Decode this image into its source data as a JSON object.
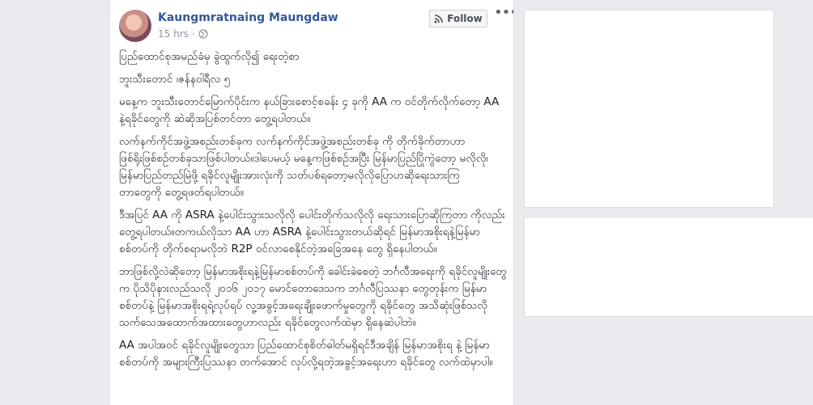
{
  "post": {
    "author": "Kaungmratnaing Maungdaw",
    "time": "15 hrs",
    "separator": "·",
    "privacy_icon": "globe-icon",
    "follow_label": "Follow",
    "follow_icon": "rss-icon",
    "more_label": "•••",
    "paragraphs": [
      "ပြည်ထောင်စုအမည်ခံမှ ခွဲထွက်လို၍ ရေးတဲ့စာ",
      "ဘူးသီးတောင် ၊ဇန်နဝါရီလ ၅",
      "မနေ့က ဘူးသီးတောင်မြောက်ပိုင်းက နယ်ခြားစောင့်စခန်း ၄ ခုကို AA က ဝင်တိုက်လိုက်တော့ AA နဲ့ရခိုင်တွေကို ဆဲဆိုအပြစ်တင်တာ တွေ့ရပါတယ်။",
      "လက်နက်ကိုင်အဖွဲ့အစည်းတစ်ခုက လက်နက်ကိုင်အဖွဲ့အစည်းတစ်ခု ကို တိုက်ခိုက်တာဟာ ဖြစ်ရိုးဖြစ်စဉ်တစ်ခုသာဖြစ်ပါတယ်။ဒါပေမယ့် မနေ့ကဖြစ်စဉ်အပြီး မြန်မာပြည်ပြိုကွဲတော့ မလိုလို၊မြန်မာပြည်တည်မြဲဖို့ ရခိုင်လူမျိုးအားလုံးကို သတ်ပစ်ရတော့မလိုလိုပြောဟဆိုရေးသားကြ\nတာတွေကို တွေ့ရဖတ်ရပါတယ်။",
      "ဒီအပြင် AA ကို ASRA နဲ့ပေါင်းသွားသလိုလို ပေါင်းတိုက်သလိုလို ရေးသားပြောဆိုကြတာ ကိုလည်း တွေ့ရပါတယ်။တကယ်လိုသာ AA ဟာ ASRA နဲ့ပေါင်းသွားတယ်ဆိုရင် မြန်မာအစိုးရနဲ့မြန်မာစစ်တပ်ကို တိုက်စရာမလိုဘဲ R2P ဝင်လာစေနိုင်တဲ့အခြေအနေ တွေ ရှိနေပါတယ်။",
      "ဘာဖြစ်လို့လဲဆိုတော့ မြန်မာအစိုးရနဲ့မြန်မာစစ်တပ်ကို ခေါင်းခဲစေတဲ့ ဘင်္ဂလီအရေးကို ရခိုင်လူမျိုးတွေက ပိုသိပိုနားလည်သလို ၂၀၁၆ ၂၀၁၇ မောင်တောဒေသက ဘင်္ဂလီပြဿနာ တွေတုန်းက မြန်မာစစ်တပ်နဲ့ မြန်မာအစိုးရရဲ့လုပ်ရပ် လူ့အခွင့်အရေးချိုးဖောက်မှုတွေကို ရခိုင်တွေ အသိဆုံးဖြစ်သလို သက်သေအထောက်အထားတွေဟာလည်း ရခိုင်တွေလက်ထဲမှာ ရှိနေဆဲပါဘဲ။",
      "AA အပါအဝင် ရခိုင်လူမျိုးတွေသာ ပြည်ထောင်စုစိတ်ဓါတ်မရှိရင်ဒီအချိန် မြန်မာအစိုးရ နဲ့ မြန်မာစစ်တပ်ကို အများကြီးပြဿနာ တက်အောင် လုပ်လို့ရတဲ့အခွင့်အရေးဟာ ရခိုင်တွေ လက်ထဲမှာပါ။"
    ]
  },
  "colors": {
    "author_link": "#365899",
    "background": "#e9ebee",
    "card": "#ffffff"
  }
}
